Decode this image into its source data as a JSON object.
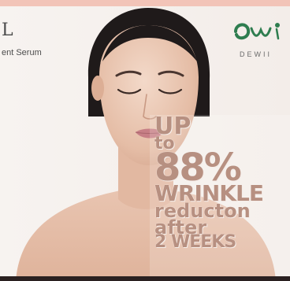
{
  "ad": {
    "brand_left": "L",
    "product_name": "ent Serum",
    "logo_text": "DEWII",
    "headline": {
      "line1": "UP",
      "line2": "to",
      "line3": "88%",
      "line4": "WRINKLE",
      "line5": "reducton",
      "line6": "after",
      "line7": "2 WEEKS"
    }
  },
  "colors": {
    "top_band": "#f2c4b8",
    "headline_text": "#b79081",
    "logo_green": "#2e7d4f",
    "background": "#f6f1ee"
  }
}
